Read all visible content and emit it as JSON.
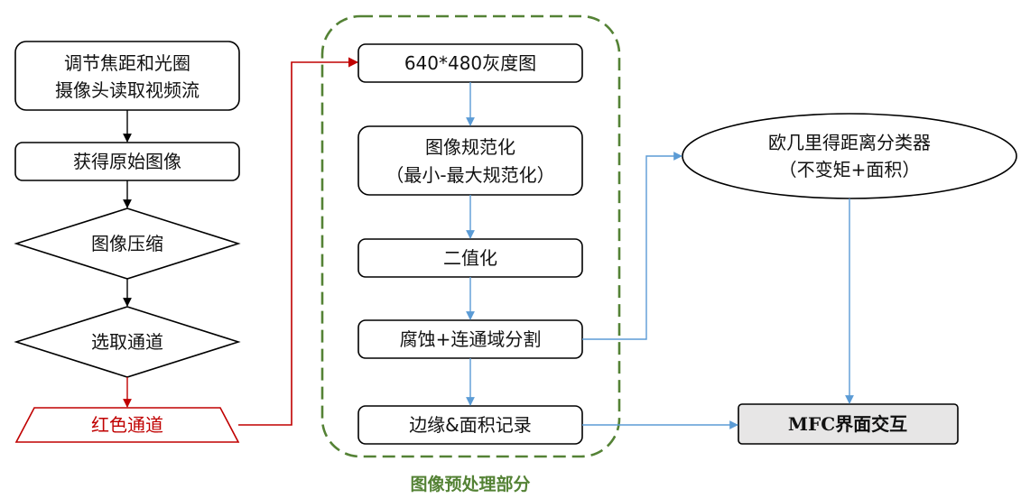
{
  "colors": {
    "black_arrow": "#000000",
    "red": "#c00000",
    "blue_arrow": "#5b9bd5",
    "group_border": "#548235",
    "group_caption": "#548235",
    "mfc_fill": "#e7e6e6"
  },
  "left_flow": {
    "step1_line1": "调节焦距和光圈",
    "step1_line2": "摄像头读取视频流",
    "step2": "获得原始图像",
    "step3": "图像压缩",
    "step4": "选取通道",
    "step5": "红色通道"
  },
  "preprocess": {
    "caption": "图像预处理部分",
    "step1": "640*480灰度图",
    "step2_line1": "图像规范化",
    "step2_line2": "（最小-最大规范化）",
    "step3": "二值化",
    "step4": "腐蚀+连通域分割",
    "step5": "边缘&面积记录"
  },
  "right_flow": {
    "classifier_line1": "欧几里得距离分类器",
    "classifier_line2": "（不变矩+面积）",
    "mfc": "MFC界面交互"
  }
}
